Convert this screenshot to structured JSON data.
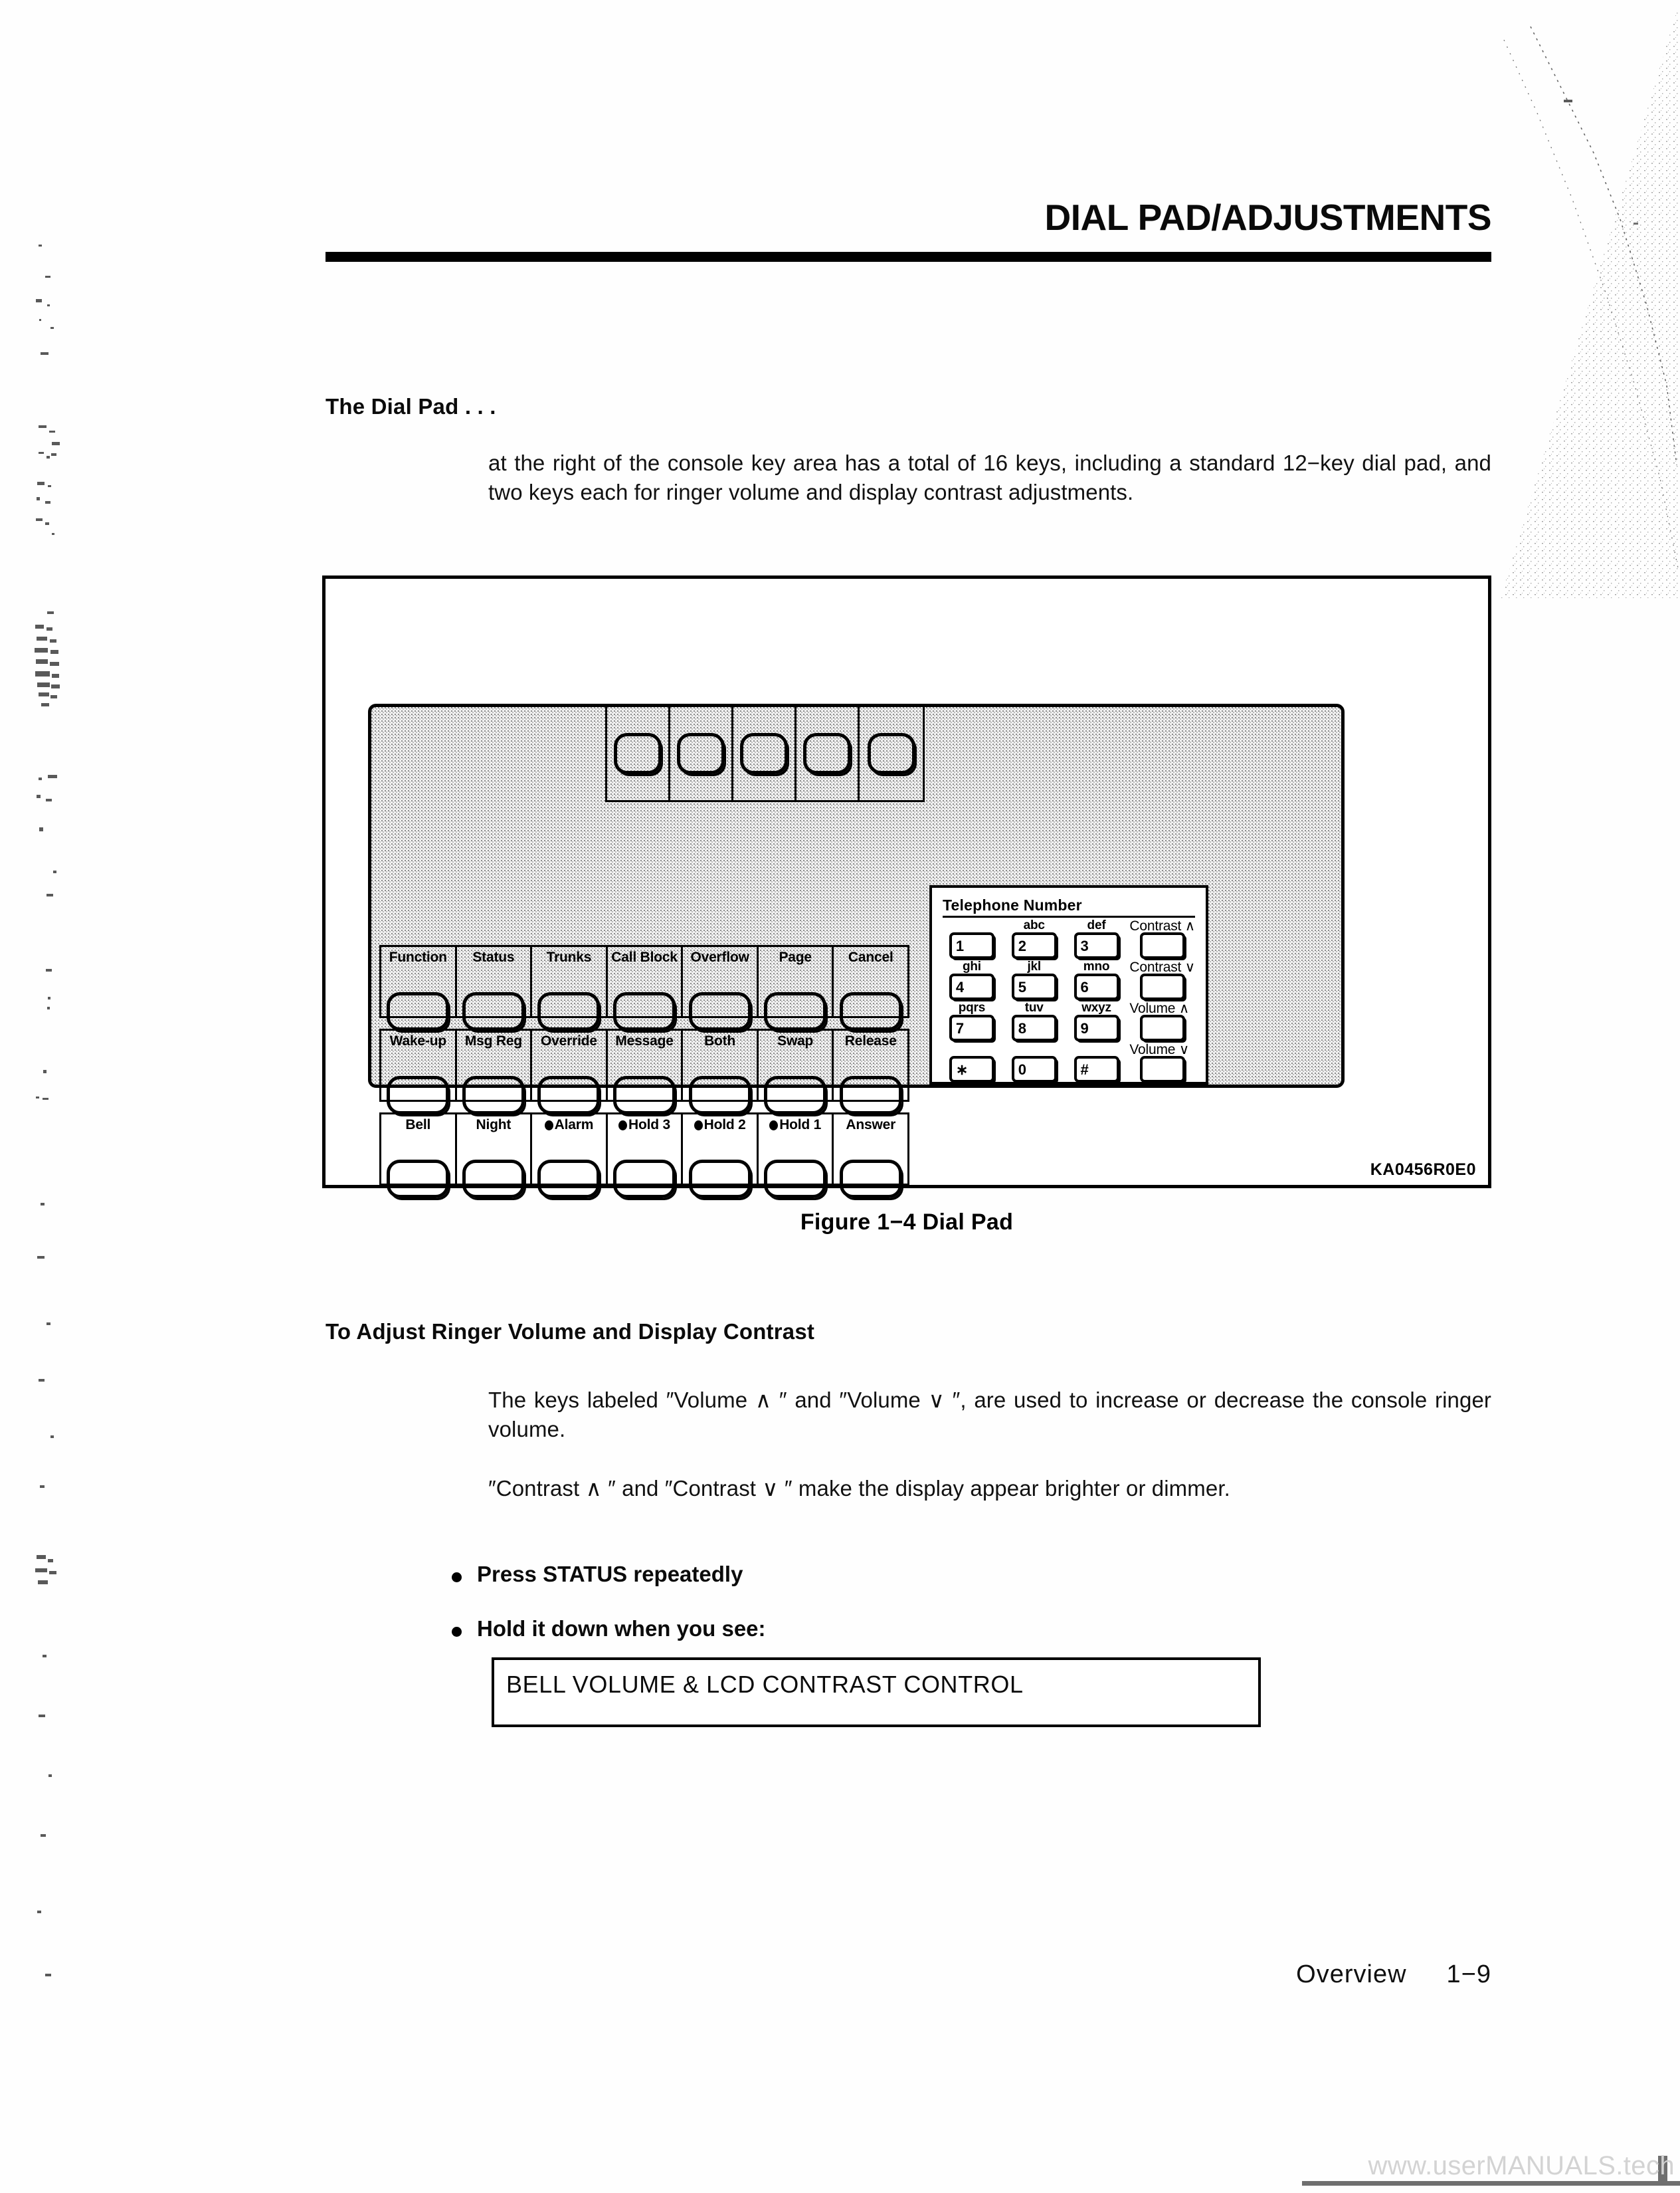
{
  "header": {
    "title": "DIAL PAD/ADJUSTMENTS"
  },
  "sections": {
    "intro_heading": "The Dial Pad . . .",
    "intro_paragraph": "at the right of the console key area has a total of 16 keys, including a standard 12−key dial pad, and two keys each for ringer volume and display contrast adjustments.",
    "adjust_heading": "To Adjust Ringer Volume and Display Contrast",
    "volume_paragraph": "The keys labeled ″Volume ∧ ″ and ″Volume ∨ ″, are used to increase or decrease the console ringer volume.",
    "contrast_paragraph": "″Contrast ∧ ″ and ″Contrast ∨ ″ make the display appear brighter or dimmer.",
    "bullets": [
      "Press STATUS repeatedly",
      "Hold it down when you see:"
    ],
    "lcd_message": "BELL VOLUME & LCD CONTRAST CONTROL"
  },
  "figure": {
    "caption": "Figure 1−4  Dial Pad",
    "part_number": "KA0456R0E0",
    "softkeys": [
      {
        "label": ""
      },
      {
        "label": ""
      },
      {
        "label": ""
      },
      {
        "label": ""
      },
      {
        "label": ""
      }
    ],
    "key_rows": [
      [
        {
          "label": "Function",
          "led": false
        },
        {
          "label": "Status",
          "led": false
        },
        {
          "label": "Trunks",
          "led": false
        },
        {
          "label": "Call Block",
          "led": false
        },
        {
          "label": "Overflow",
          "led": false
        },
        {
          "label": "Page",
          "led": false
        },
        {
          "label": "Cancel",
          "led": false
        }
      ],
      [
        {
          "label": "Wake-up",
          "led": false
        },
        {
          "label": "Msg Reg",
          "led": false
        },
        {
          "label": "Override",
          "led": false
        },
        {
          "label": "Message",
          "led": false
        },
        {
          "label": "Both",
          "led": false
        },
        {
          "label": "Swap",
          "led": false
        },
        {
          "label": "Release",
          "led": false
        }
      ],
      [
        {
          "label": "Bell",
          "led": false
        },
        {
          "label": "Night",
          "led": false
        },
        {
          "label": "Alarm",
          "led": true
        },
        {
          "label": "Hold 3",
          "led": true
        },
        {
          "label": "Hold 2",
          "led": true
        },
        {
          "label": "Hold 1",
          "led": true
        },
        {
          "label": "Answer",
          "led": false
        }
      ]
    ],
    "keypad": {
      "title": "Telephone Number",
      "rows": [
        [
          {
            "sub": "",
            "key": "1",
            "side": false
          },
          {
            "sub": "abc",
            "key": "2",
            "side": false
          },
          {
            "sub": "def",
            "key": "3",
            "side": false
          },
          {
            "sub": "Contrast ∧",
            "key": "",
            "side": true
          }
        ],
        [
          {
            "sub": "ghi",
            "key": "4",
            "side": false
          },
          {
            "sub": "jkl",
            "key": "5",
            "side": false
          },
          {
            "sub": "mno",
            "key": "6",
            "side": false
          },
          {
            "sub": "Contrast ∨",
            "key": "",
            "side": true
          }
        ],
        [
          {
            "sub": "pqrs",
            "key": "7",
            "side": false
          },
          {
            "sub": "tuv",
            "key": "8",
            "side": false
          },
          {
            "sub": "wxyz",
            "key": "9",
            "side": false
          },
          {
            "sub": "Volume ∧",
            "key": "",
            "side": true
          }
        ],
        [
          {
            "sub": "",
            "key": "∗",
            "side": false
          },
          {
            "sub": "",
            "key": "0",
            "side": false
          },
          {
            "sub": "",
            "key": "#",
            "side": false
          },
          {
            "sub": "Volume ∨",
            "key": "",
            "side": true
          }
        ]
      ]
    }
  },
  "footer": {
    "section": "Overview",
    "page_number": "1−9"
  },
  "watermark": "www.userMANUALS.tech"
}
